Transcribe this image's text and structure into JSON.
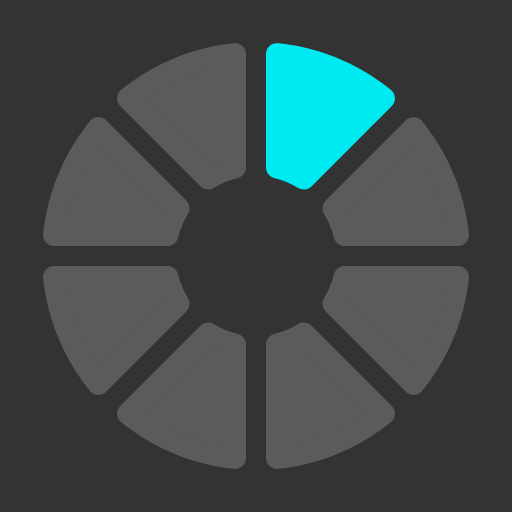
{
  "icon": {
    "name": "loading-spinner-icon",
    "segment_count": 8,
    "active_segment": 0,
    "active_count": 1
  },
  "colors": {
    "background": "#333333",
    "inactive": "#5b5b5b",
    "active": "#00eaf2"
  }
}
